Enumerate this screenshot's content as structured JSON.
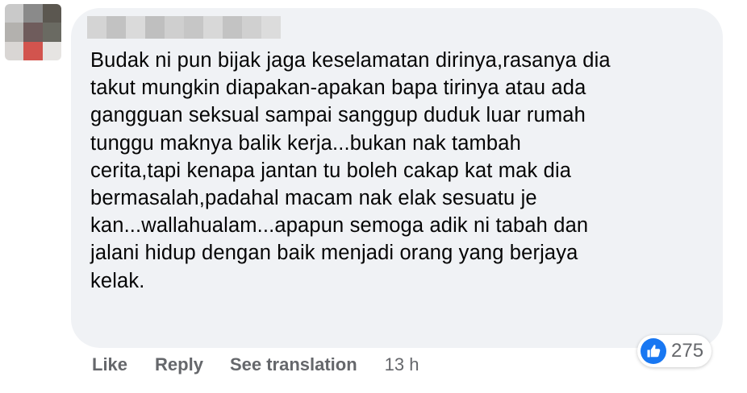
{
  "comment": {
    "text": "Budak ni pun bijak jaga keselamatan dirinya,rasanya dia\ntakut mungkin diapakan-apakan bapa tirinya atau ada\ngangguan seksual sampai sanggup duduk luar rumah\ntunggu maknya balik kerja...bukan nak tambah\ncerita,tapi kenapa jantan tu boleh cakap kat mak dia\nbermasalah,padahal macam nak elak sesuatu je\nkan...wallahualam...apapun semoga adik ni tabah dan\njalani hidup dengan baik menjadi orang yang berjaya\nkelak."
  },
  "reactions": {
    "icon": "thumbs-up-icon",
    "count": "275",
    "color": "#1877f2"
  },
  "actions": {
    "like": "Like",
    "reply": "Reply",
    "see_translation": "See translation",
    "timestamp": "13 h"
  },
  "colors": {
    "bubble": "#f0f2f5",
    "text": "#050505",
    "secondary": "#65676b"
  }
}
